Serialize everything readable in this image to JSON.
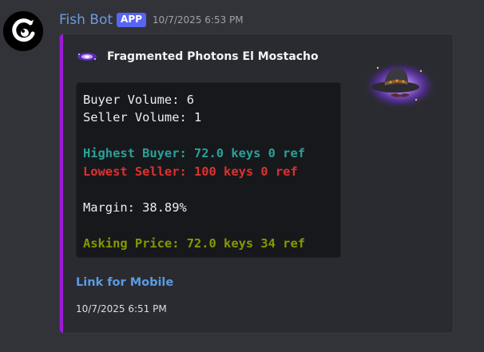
{
  "message": {
    "author": "Fish Bot",
    "badge": "APP",
    "timestamp": "10/7/2025 6:53 PM"
  },
  "embed": {
    "accent_color": "#9b1bd8",
    "author_name": "Fragmented Photons El Mostacho",
    "code_lines": {
      "buyer_volume": "Buyer Volume: 6",
      "seller_volume": "Seller Volume: 1",
      "highest_buyer": "Highest Buyer: 72.0 keys 0 ref",
      "lowest_seller": "Lowest Seller: 100 keys 0 ref",
      "margin": "Margin: 38.89%",
      "asking_price": "Asking Price: 72.0 keys 34 ref"
    },
    "link_label": "Link for Mobile",
    "footer_timestamp": "10/7/2025 6:51 PM"
  },
  "icons": {
    "avatar": "fish-bot-avatar-icon",
    "author_icon": "photon-sparkle-icon",
    "thumbnail": "mustache-hat-item-icon"
  }
}
